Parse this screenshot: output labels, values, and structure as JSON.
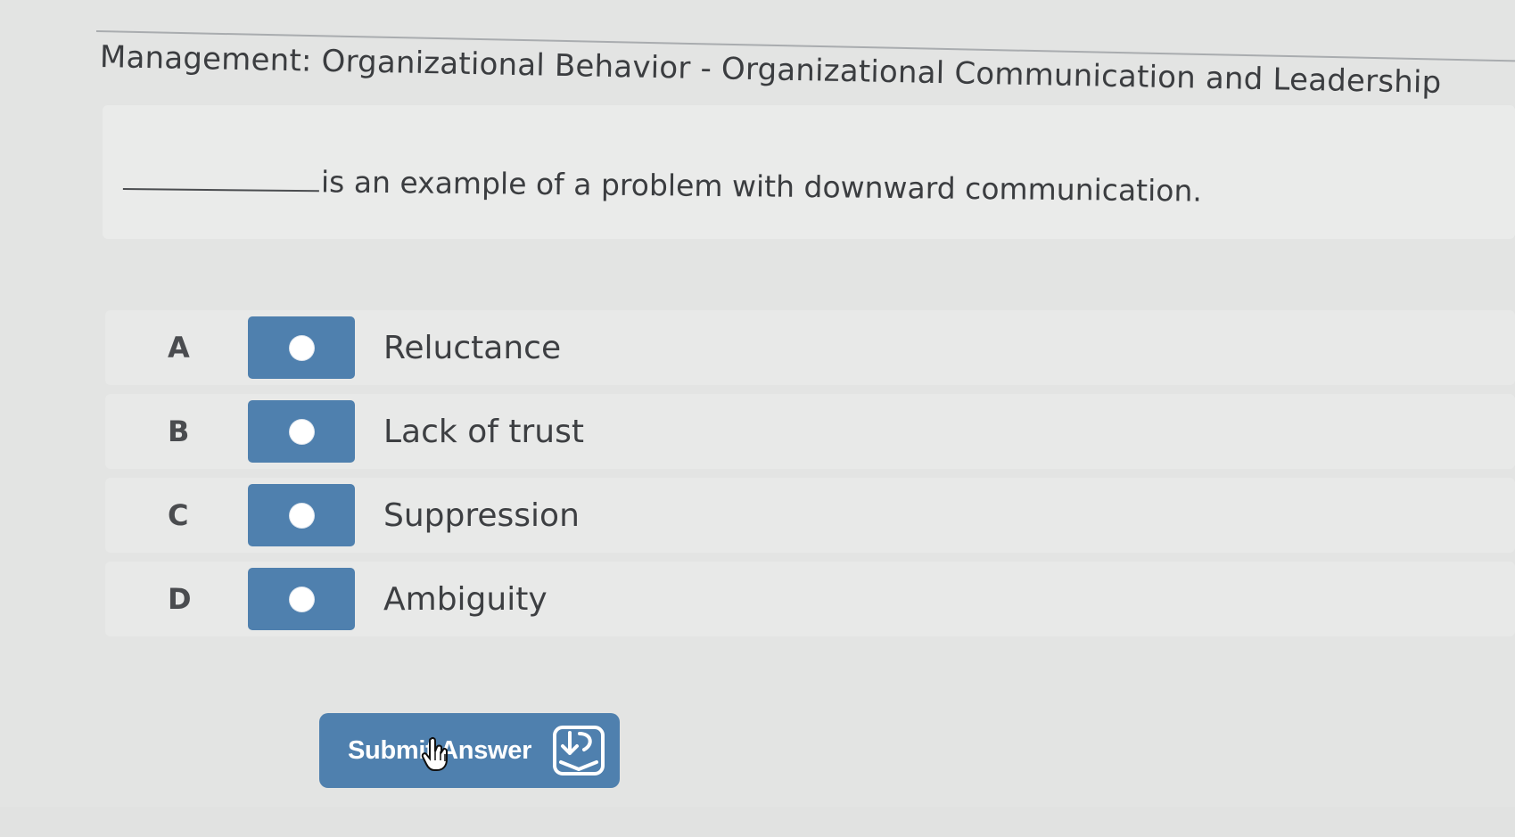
{
  "page": {
    "title": "Management: Organizational Behavior - Organizational Communication and Leadership"
  },
  "question": {
    "text": "is an example of a problem with downward communication."
  },
  "options": [
    {
      "letter": "A",
      "label": "Reluctance"
    },
    {
      "letter": "B",
      "label": "Lack of trust"
    },
    {
      "letter": "C",
      "label": "Suppression"
    },
    {
      "letter": "D",
      "label": "Ambiguity"
    }
  ],
  "submit": {
    "label": "Submit Answer",
    "icon": "submit-tray-arrow-icon"
  },
  "icons": {
    "radio": "radio-unselected-icon",
    "cursor": "hand-pointer-icon"
  },
  "colors": {
    "accent": "#4f80ae",
    "background": "#e3e4e3",
    "text": "#3b3d40"
  }
}
